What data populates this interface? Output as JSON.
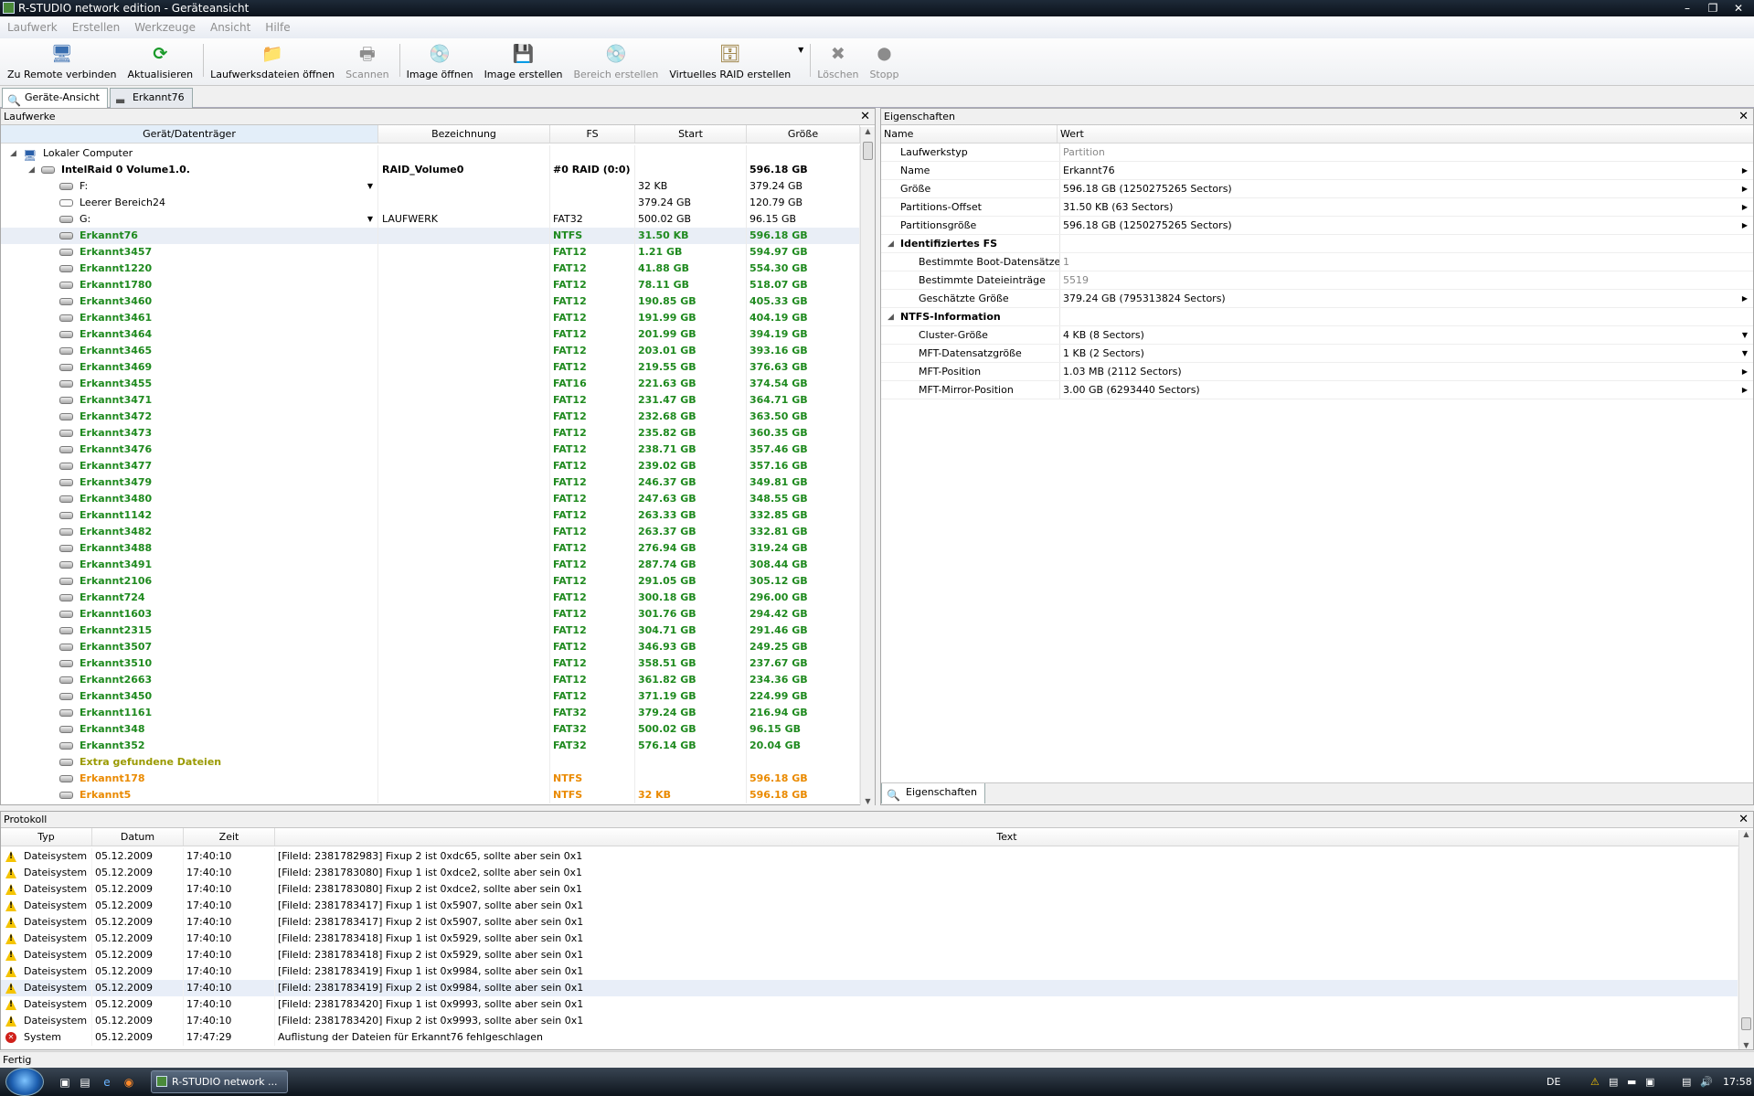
{
  "window": {
    "title": "R-STUDIO network edition - Geräteansicht"
  },
  "menu": [
    "Laufwerk",
    "Erstellen",
    "Werkzeuge",
    "Ansicht",
    "Hilfe"
  ],
  "toolbar": {
    "remote": "Zu Remote verbinden",
    "refresh": "Aktualisieren",
    "open_files": "Laufwerksdateien öffnen",
    "scan": "Scannen",
    "open_image": "Image öffnen",
    "create_image": "Image erstellen",
    "create_region": "Bereich erstellen",
    "virtual_raid": "Virtuelles RAID erstellen",
    "delete": "Löschen",
    "stop": "Stopp"
  },
  "tabs": [
    "Geräte-Ansicht",
    "Erkannt76"
  ],
  "drives_panel": {
    "title": "Laufwerke",
    "columns": [
      "Gerät/Datenträger",
      "Bezeichnung",
      "FS",
      "Start",
      "Größe"
    ],
    "rows": [
      {
        "name": "Lokaler Computer",
        "label": "",
        "fs": "",
        "start": "",
        "size": "",
        "style": "plain",
        "indent": 1,
        "type": "computer"
      },
      {
        "name": "IntelRaid 0 Volume1.0.",
        "label": "RAID_Volume0",
        "fs": "#0 RAID (0:0)",
        "start": "",
        "size": "596.18 GB",
        "style": "bold",
        "indent": 2,
        "type": "raid"
      },
      {
        "name": "F:",
        "label": "",
        "fs": "",
        "start": "32 KB",
        "size": "379.24 GB",
        "style": "plain",
        "indent": 3,
        "type": "disk",
        "dd": true
      },
      {
        "name": "Leerer Bereich24",
        "label": "",
        "fs": "",
        "start": "379.24 GB",
        "size": "120.79 GB",
        "style": "plain",
        "indent": 3,
        "type": "empty"
      },
      {
        "name": "G:",
        "label": "LAUFWERK",
        "fs": "FAT32",
        "start": "500.02 GB",
        "size": "96.15 GB",
        "style": "plain",
        "indent": 3,
        "type": "disk",
        "dd": true
      },
      {
        "name": "Erkannt76",
        "label": "",
        "fs": "NTFS",
        "start": "31.50 KB",
        "size": "596.18 GB",
        "style": "green",
        "indent": 3,
        "type": "disk",
        "sel": true
      },
      {
        "name": "Erkannt3457",
        "label": "",
        "fs": "FAT12",
        "start": "1.21 GB",
        "size": "594.97 GB",
        "style": "green",
        "indent": 3,
        "type": "disk"
      },
      {
        "name": "Erkannt1220",
        "label": "",
        "fs": "FAT12",
        "start": "41.88 GB",
        "size": "554.30 GB",
        "style": "green",
        "indent": 3,
        "type": "disk"
      },
      {
        "name": "Erkannt1780",
        "label": "",
        "fs": "FAT12",
        "start": "78.11 GB",
        "size": "518.07 GB",
        "style": "green",
        "indent": 3,
        "type": "disk"
      },
      {
        "name": "Erkannt3460",
        "label": "",
        "fs": "FAT12",
        "start": "190.85 GB",
        "size": "405.33 GB",
        "style": "green",
        "indent": 3,
        "type": "disk"
      },
      {
        "name": "Erkannt3461",
        "label": "",
        "fs": "FAT12",
        "start": "191.99 GB",
        "size": "404.19 GB",
        "style": "green",
        "indent": 3,
        "type": "disk"
      },
      {
        "name": "Erkannt3464",
        "label": "",
        "fs": "FAT12",
        "start": "201.99 GB",
        "size": "394.19 GB",
        "style": "green",
        "indent": 3,
        "type": "disk"
      },
      {
        "name": "Erkannt3465",
        "label": "",
        "fs": "FAT12",
        "start": "203.01 GB",
        "size": "393.16 GB",
        "style": "green",
        "indent": 3,
        "type": "disk"
      },
      {
        "name": "Erkannt3469",
        "label": "",
        "fs": "FAT12",
        "start": "219.55 GB",
        "size": "376.63 GB",
        "style": "green",
        "indent": 3,
        "type": "disk"
      },
      {
        "name": "Erkannt3455",
        "label": "",
        "fs": "FAT16",
        "start": "221.63 GB",
        "size": "374.54 GB",
        "style": "green",
        "indent": 3,
        "type": "disk"
      },
      {
        "name": "Erkannt3471",
        "label": "",
        "fs": "FAT12",
        "start": "231.47 GB",
        "size": "364.71 GB",
        "style": "green",
        "indent": 3,
        "type": "disk"
      },
      {
        "name": "Erkannt3472",
        "label": "",
        "fs": "FAT12",
        "start": "232.68 GB",
        "size": "363.50 GB",
        "style": "green",
        "indent": 3,
        "type": "disk"
      },
      {
        "name": "Erkannt3473",
        "label": "",
        "fs": "FAT12",
        "start": "235.82 GB",
        "size": "360.35 GB",
        "style": "green",
        "indent": 3,
        "type": "disk"
      },
      {
        "name": "Erkannt3476",
        "label": "",
        "fs": "FAT12",
        "start": "238.71 GB",
        "size": "357.46 GB",
        "style": "green",
        "indent": 3,
        "type": "disk"
      },
      {
        "name": "Erkannt3477",
        "label": "",
        "fs": "FAT12",
        "start": "239.02 GB",
        "size": "357.16 GB",
        "style": "green",
        "indent": 3,
        "type": "disk"
      },
      {
        "name": "Erkannt3479",
        "label": "",
        "fs": "FAT12",
        "start": "246.37 GB",
        "size": "349.81 GB",
        "style": "green",
        "indent": 3,
        "type": "disk"
      },
      {
        "name": "Erkannt3480",
        "label": "",
        "fs": "FAT12",
        "start": "247.63 GB",
        "size": "348.55 GB",
        "style": "green",
        "indent": 3,
        "type": "disk"
      },
      {
        "name": "Erkannt1142",
        "label": "",
        "fs": "FAT12",
        "start": "263.33 GB",
        "size": "332.85 GB",
        "style": "green",
        "indent": 3,
        "type": "disk"
      },
      {
        "name": "Erkannt3482",
        "label": "",
        "fs": "FAT12",
        "start": "263.37 GB",
        "size": "332.81 GB",
        "style": "green",
        "indent": 3,
        "type": "disk"
      },
      {
        "name": "Erkannt3488",
        "label": "",
        "fs": "FAT12",
        "start": "276.94 GB",
        "size": "319.24 GB",
        "style": "green",
        "indent": 3,
        "type": "disk"
      },
      {
        "name": "Erkannt3491",
        "label": "",
        "fs": "FAT12",
        "start": "287.74 GB",
        "size": "308.44 GB",
        "style": "green",
        "indent": 3,
        "type": "disk"
      },
      {
        "name": "Erkannt2106",
        "label": "",
        "fs": "FAT12",
        "start": "291.05 GB",
        "size": "305.12 GB",
        "style": "green",
        "indent": 3,
        "type": "disk"
      },
      {
        "name": "Erkannt724",
        "label": "",
        "fs": "FAT12",
        "start": "300.18 GB",
        "size": "296.00 GB",
        "style": "green",
        "indent": 3,
        "type": "disk"
      },
      {
        "name": "Erkannt1603",
        "label": "",
        "fs": "FAT12",
        "start": "301.76 GB",
        "size": "294.42 GB",
        "style": "green",
        "indent": 3,
        "type": "disk"
      },
      {
        "name": "Erkannt2315",
        "label": "",
        "fs": "FAT12",
        "start": "304.71 GB",
        "size": "291.46 GB",
        "style": "green",
        "indent": 3,
        "type": "disk"
      },
      {
        "name": "Erkannt3507",
        "label": "",
        "fs": "FAT12",
        "start": "346.93 GB",
        "size": "249.25 GB",
        "style": "green",
        "indent": 3,
        "type": "disk"
      },
      {
        "name": "Erkannt3510",
        "label": "",
        "fs": "FAT12",
        "start": "358.51 GB",
        "size": "237.67 GB",
        "style": "green",
        "indent": 3,
        "type": "disk"
      },
      {
        "name": "Erkannt2663",
        "label": "",
        "fs": "FAT12",
        "start": "361.82 GB",
        "size": "234.36 GB",
        "style": "green",
        "indent": 3,
        "type": "disk"
      },
      {
        "name": "Erkannt3450",
        "label": "",
        "fs": "FAT12",
        "start": "371.19 GB",
        "size": "224.99 GB",
        "style": "green",
        "indent": 3,
        "type": "disk"
      },
      {
        "name": "Erkannt1161",
        "label": "",
        "fs": "FAT32",
        "start": "379.24 GB",
        "size": "216.94 GB",
        "style": "green",
        "indent": 3,
        "type": "disk"
      },
      {
        "name": "Erkannt348",
        "label": "",
        "fs": "FAT32",
        "start": "500.02 GB",
        "size": "96.15 GB",
        "style": "green",
        "indent": 3,
        "type": "disk"
      },
      {
        "name": "Erkannt352",
        "label": "",
        "fs": "FAT32",
        "start": "576.14 GB",
        "size": "20.04 GB",
        "style": "green",
        "indent": 3,
        "type": "disk"
      },
      {
        "name": "Extra gefundene Dateien",
        "label": "",
        "fs": "",
        "start": "",
        "size": "",
        "style": "olive",
        "indent": 3,
        "type": "disk"
      },
      {
        "name": "Erkannt178",
        "label": "",
        "fs": "NTFS",
        "start": "",
        "size": "596.18 GB",
        "style": "orange",
        "indent": 3,
        "type": "disk"
      },
      {
        "name": "Erkannt5",
        "label": "",
        "fs": "NTFS",
        "start": "32 KB",
        "size": "596.18 GB",
        "style": "orange",
        "indent": 3,
        "type": "disk"
      }
    ]
  },
  "props_panel": {
    "title": "Eigenschaften",
    "columns": [
      "Name",
      "Wert"
    ],
    "rows": [
      {
        "name": "Laufwerkstyp",
        "value": "Partition",
        "level": 1,
        "gray": true
      },
      {
        "name": "Name",
        "value": "Erkannt76",
        "level": 1,
        "arrow": "right"
      },
      {
        "name": "Größe",
        "value": "596.18 GB (1250275265 Sectors)",
        "level": 1,
        "arrow": "right"
      },
      {
        "name": "Partitions-Offset",
        "value": "31.50 KB (63 Sectors)",
        "level": 1,
        "arrow": "right"
      },
      {
        "name": "Partitionsgröße",
        "value": "596.18 GB (1250275265 Sectors)",
        "level": 1,
        "arrow": "right"
      },
      {
        "name": "Identifiziertes FS",
        "value": "",
        "level": 0,
        "group": true
      },
      {
        "name": "Bestimmte Boot-Datensätze",
        "value": "1",
        "level": 2,
        "gray": true
      },
      {
        "name": "Bestimmte Dateieinträge",
        "value": "5519",
        "level": 2,
        "gray": true
      },
      {
        "name": "Geschätzte Größe",
        "value": "379.24 GB (795313824 Sectors)",
        "level": 2,
        "arrow": "right"
      },
      {
        "name": "NTFS-Information",
        "value": "",
        "level": 0,
        "group": true
      },
      {
        "name": "Cluster-Größe",
        "value": "4 KB (8 Sectors)",
        "level": 2,
        "arrow": "down"
      },
      {
        "name": "MFT-Datensatzgröße",
        "value": "1 KB (2 Sectors)",
        "level": 2,
        "arrow": "down"
      },
      {
        "name": "MFT-Position",
        "value": "1.03 MB (2112 Sectors)",
        "level": 2,
        "arrow": "right"
      },
      {
        "name": "MFT-Mirror-Position",
        "value": "3.00 GB (6293440 Sectors)",
        "level": 2,
        "arrow": "right"
      }
    ],
    "bottom_tab": "Eigenschaften"
  },
  "log_panel": {
    "title": "Protokoll",
    "columns": [
      "Typ",
      "Datum",
      "Zeit",
      "Text"
    ],
    "rows": [
      {
        "type": "Dateisystem",
        "date": "05.12.2009",
        "time": "17:40:10",
        "text": "[FileId: 2381782983] Fixup 2 ist 0xdc65, sollte aber sein 0x1",
        "icon": "warn"
      },
      {
        "type": "Dateisystem",
        "date": "05.12.2009",
        "time": "17:40:10",
        "text": "[FileId: 2381783080] Fixup 1 ist 0xdce2, sollte aber sein 0x1",
        "icon": "warn"
      },
      {
        "type": "Dateisystem",
        "date": "05.12.2009",
        "time": "17:40:10",
        "text": "[FileId: 2381783080] Fixup 2 ist 0xdce2, sollte aber sein 0x1",
        "icon": "warn"
      },
      {
        "type": "Dateisystem",
        "date": "05.12.2009",
        "time": "17:40:10",
        "text": "[FileId: 2381783417] Fixup 1 ist 0x5907, sollte aber sein 0x1",
        "icon": "warn"
      },
      {
        "type": "Dateisystem",
        "date": "05.12.2009",
        "time": "17:40:10",
        "text": "[FileId: 2381783417] Fixup 2 ist 0x5907, sollte aber sein 0x1",
        "icon": "warn"
      },
      {
        "type": "Dateisystem",
        "date": "05.12.2009",
        "time": "17:40:10",
        "text": "[FileId: 2381783418] Fixup 1 ist 0x5929, sollte aber sein 0x1",
        "icon": "warn"
      },
      {
        "type": "Dateisystem",
        "date": "05.12.2009",
        "time": "17:40:10",
        "text": "[FileId: 2381783418] Fixup 2 ist 0x5929, sollte aber sein 0x1",
        "icon": "warn"
      },
      {
        "type": "Dateisystem",
        "date": "05.12.2009",
        "time": "17:40:10",
        "text": "[FileId: 2381783419] Fixup 1 ist 0x9984, sollte aber sein 0x1",
        "icon": "warn"
      },
      {
        "type": "Dateisystem",
        "date": "05.12.2009",
        "time": "17:40:10",
        "text": "[FileId: 2381783419] Fixup 2 ist 0x9984, sollte aber sein 0x1",
        "icon": "warn",
        "sel": true
      },
      {
        "type": "Dateisystem",
        "date": "05.12.2009",
        "time": "17:40:10",
        "text": "[FileId: 2381783420] Fixup 1 ist 0x9993, sollte aber sein 0x1",
        "icon": "warn"
      },
      {
        "type": "Dateisystem",
        "date": "05.12.2009",
        "time": "17:40:10",
        "text": "[FileId: 2381783420] Fixup 2 ist 0x9993, sollte aber sein 0x1",
        "icon": "warn"
      },
      {
        "type": "System",
        "date": "05.12.2009",
        "time": "17:47:29",
        "text": "Auflistung der Dateien für Erkannt76 fehlgeschlagen",
        "icon": "err"
      }
    ]
  },
  "status": {
    "text": "Fertig"
  },
  "taskbar": {
    "task": "R-STUDIO network ...",
    "lang": "DE",
    "clock": "17:58"
  }
}
